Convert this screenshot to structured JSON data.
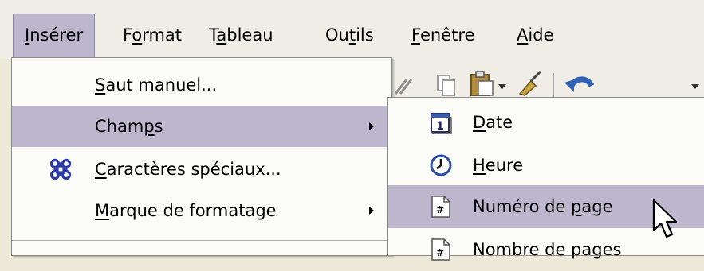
{
  "menubar": {
    "items": [
      {
        "pre": "",
        "ul": "I",
        "post": "nsérer"
      },
      {
        "pre": "F",
        "ul": "o",
        "post": "rmat"
      },
      {
        "pre": "T",
        "ul": "a",
        "post": "bleau"
      },
      {
        "pre": "Ou",
        "ul": "t",
        "post": "ils"
      },
      {
        "pre": "",
        "ul": "F",
        "post": "enêtre"
      },
      {
        "pre": "",
        "ul": "A",
        "post": "ide"
      }
    ]
  },
  "insert_menu": {
    "items": [
      {
        "pre": "",
        "ul": "S",
        "post": "aut manuel...",
        "icon": ""
      },
      {
        "pre": "Cham",
        "ul": "p",
        "post": "s",
        "icon": "",
        "submenu": true
      },
      {
        "pre": "",
        "ul": "C",
        "post": "aractères spéciaux...",
        "icon": "special-characters-icon"
      },
      {
        "pre": "",
        "ul": "M",
        "post": "arque de formatage",
        "icon": "",
        "submenu": true
      }
    ]
  },
  "fields_submenu": {
    "items": [
      {
        "pre": "",
        "ul": "D",
        "post": "ate",
        "icon": "calendar-date-icon",
        "icon_text": "1"
      },
      {
        "pre": "",
        "ul": "H",
        "post": "eure",
        "icon": "clock-icon"
      },
      {
        "pre": "Numéro de ",
        "ul": "p",
        "post": "age",
        "icon": "page-number-icon",
        "icon_text": "#"
      },
      {
        "pre": "Nombre de pages",
        "ul": "",
        "post": "",
        "icon": "page-count-icon",
        "icon_text": "#"
      }
    ]
  },
  "colors": {
    "highlight": "#bcb7cc",
    "menu_bg": "#fbfbf8",
    "bar_bg": "#efede5"
  }
}
